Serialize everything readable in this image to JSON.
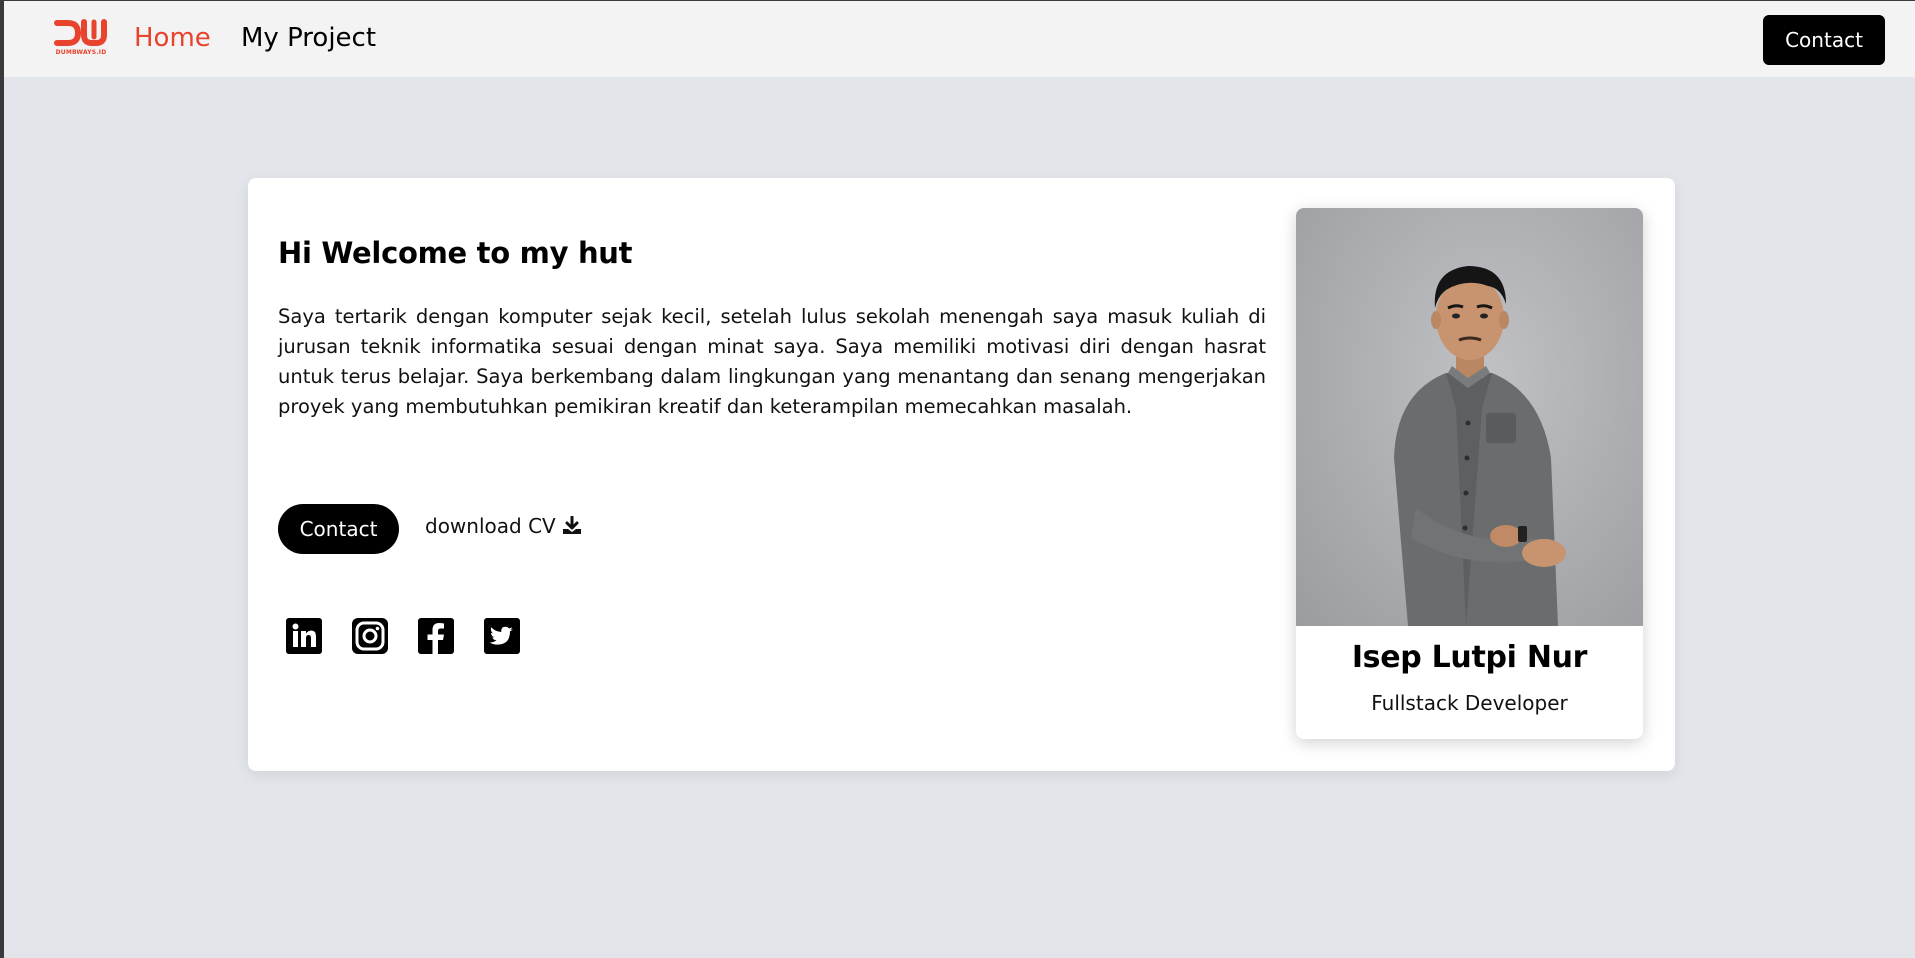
{
  "navbar": {
    "logo_text": "DW",
    "logo_subtext": "DUMBWAYS.ID",
    "links": [
      {
        "label": "Home",
        "active": true
      },
      {
        "label": "My Project",
        "active": false
      }
    ],
    "contact_label": "Contact"
  },
  "hero": {
    "title": "Hi Welcome to my hut",
    "description": "Saya tertarik dengan komputer sejak kecil, setelah lulus sekolah menengah saya masuk kuliah di jurusan teknik informatika sesuai dengan minat saya. Saya memiliki motivasi diri dengan hasrat untuk terus belajar. Saya berkembang dalam lingkungan yang menantang dan senang mengerjakan proyek yang membutuhkan pemikiran kreatif dan keterampilan memecahkan masalah.",
    "contact_label": "Contact",
    "download_label": "download CV",
    "download_icon": "download-icon",
    "socials": [
      "linkedin-icon",
      "instagram-icon",
      "facebook-icon",
      "twitter-icon"
    ]
  },
  "profile": {
    "name": "Isep Lutpi Nur",
    "role": "Fullstack Developer"
  },
  "colors": {
    "accent": "#e8432d",
    "page_background": "#e2e5e9",
    "navbar_background": "#f3f3f3",
    "button": "#000000"
  }
}
